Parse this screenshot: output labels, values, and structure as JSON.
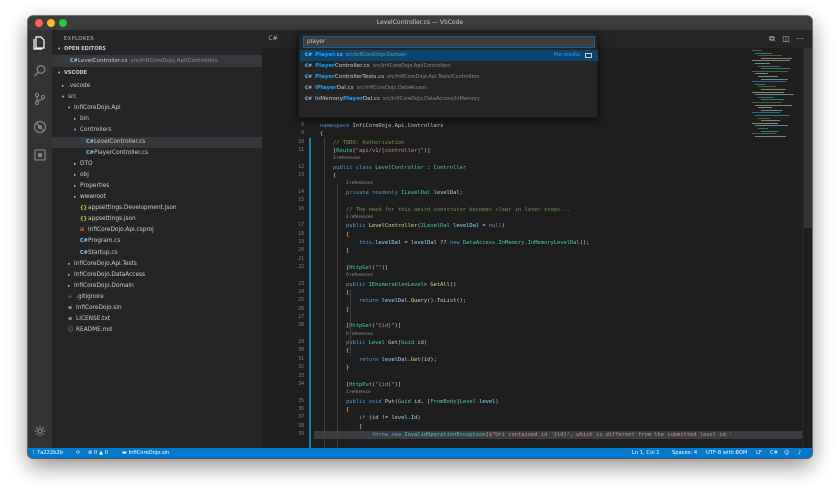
{
  "window": {
    "title": "LevelController.cs — VSCode"
  },
  "sidebar": {
    "title": "EXPLORER",
    "open_editors_label": "OPEN EDITORS",
    "open_editor": {
      "name": "LevelController.cs",
      "path": "src/InfiCoreDojo.Api/Controllers"
    },
    "workspace_label": "VSCODE",
    "tree": [
      {
        "label": ".vscode",
        "depth": 1,
        "chev": "▸",
        "icon": ""
      },
      {
        "label": "src",
        "depth": 1,
        "chev": "▾",
        "icon": ""
      },
      {
        "label": "InfiCoreDojo.Api",
        "depth": 2,
        "chev": "▾",
        "icon": ""
      },
      {
        "label": "bin",
        "depth": 3,
        "chev": "▸",
        "icon": ""
      },
      {
        "label": "Controllers",
        "depth": 3,
        "chev": "▾",
        "icon": ""
      },
      {
        "label": "LevelController.cs",
        "depth": 4,
        "chev": "",
        "icon": "C#",
        "selected": true
      },
      {
        "label": "PlayerController.cs",
        "depth": 4,
        "chev": "",
        "icon": "C#"
      },
      {
        "label": "DTO",
        "depth": 3,
        "chev": "▸",
        "icon": ""
      },
      {
        "label": "obj",
        "depth": 3,
        "chev": "▸",
        "icon": ""
      },
      {
        "label": "Properties",
        "depth": 3,
        "chev": "▸",
        "icon": ""
      },
      {
        "label": "wwwroot",
        "depth": 3,
        "chev": "▸",
        "icon": ""
      },
      {
        "label": "appsettings.Development.json",
        "depth": 3,
        "chev": "",
        "icon": "{}"
      },
      {
        "label": "appsettings.json",
        "depth": 3,
        "chev": "",
        "icon": "{}"
      },
      {
        "label": "InfiCoreDojo.Api.csproj",
        "depth": 3,
        "chev": "",
        "icon": "⊞"
      },
      {
        "label": "Program.cs",
        "depth": 3,
        "chev": "",
        "icon": "C#"
      },
      {
        "label": "Startup.cs",
        "depth": 3,
        "chev": "",
        "icon": "C#"
      },
      {
        "label": "InfiCoreDojo.Api.Tests",
        "depth": 2,
        "chev": "▸",
        "icon": ""
      },
      {
        "label": "InfiCoreDojo.DataAccess",
        "depth": 2,
        "chev": "▸",
        "icon": ""
      },
      {
        "label": "InfiCoreDojo.Domain",
        "depth": 2,
        "chev": "▸",
        "icon": ""
      },
      {
        "label": ".gitignore",
        "depth": 1,
        "chev": "",
        "icon": "◆"
      },
      {
        "label": "InfiCoreDojo.sln",
        "depth": 1,
        "chev": "",
        "icon": "≡"
      },
      {
        "label": "LICENSE.txt",
        "depth": 1,
        "chev": "",
        "icon": "≡"
      },
      {
        "label": "README.md",
        "depth": 1,
        "chev": "",
        "icon": "ⓘ"
      }
    ]
  },
  "quick_open": {
    "query": "player",
    "file_results_label": "file results",
    "results": [
      {
        "pre": "",
        "match": "Player",
        "post": ".cs",
        "path": "src/InfiCoreDojo.Domain",
        "selected": true
      },
      {
        "pre": "",
        "match": "Player",
        "post": "Controller.cs",
        "path": "src/InfiCoreDojo.Api/Controllers"
      },
      {
        "pre": "",
        "match": "Player",
        "post": "ControllerTests.cs",
        "path": "src/InfiCoreDojo.Api.Tests/Controllers"
      },
      {
        "pre": "I",
        "match": "Player",
        "post": "Dal.cs",
        "path": "src/InfiCoreDojo.DataAccess"
      },
      {
        "pre": "InMemory",
        "match": "Player",
        "post": "Dal.cs",
        "path": "src/InfiCoreDojo.DataAccess/InMemory"
      }
    ]
  },
  "code": [
    {
      "num": "8",
      "segs": [
        [
          "kw",
          "namespace "
        ],
        [
          "ns",
          "InfiCoreDojo.Api.Controllers"
        ]
      ]
    },
    {
      "num": "9",
      "segs": [
        [
          "tx",
          "{"
        ]
      ]
    },
    {
      "num": "10",
      "segs": [
        [
          "tx",
          "    "
        ],
        [
          "cm",
          "// TODO: Authorization"
        ]
      ]
    },
    {
      "num": "11",
      "segs": [
        [
          "tx",
          "    ["
        ],
        [
          "ty",
          "Route"
        ],
        [
          "tx",
          "("
        ],
        [
          "st",
          "\"api/v1/[controller]\""
        ],
        [
          "tx",
          ")]"
        ]
      ]
    },
    {
      "lens": "2 references",
      "indent": "    "
    },
    {
      "num": "12",
      "segs": [
        [
          "tx",
          "    "
        ],
        [
          "kw",
          "public class "
        ],
        [
          "ty",
          "LevelController"
        ],
        [
          "tx",
          " : "
        ],
        [
          "ty",
          "Controller"
        ]
      ]
    },
    {
      "num": "13",
      "segs": [
        [
          "tx",
          "    {"
        ]
      ]
    },
    {
      "lens": "3 references",
      "indent": "        "
    },
    {
      "num": "14",
      "segs": [
        [
          "tx",
          "        "
        ],
        [
          "kw",
          "private readonly "
        ],
        [
          "ty",
          "ILevelDal"
        ],
        [
          "tx",
          " "
        ],
        [
          "va",
          "levelDal"
        ],
        [
          "tx",
          ";"
        ]
      ]
    },
    {
      "num": "15",
      "segs": []
    },
    {
      "num": "16",
      "segs": [
        [
          "tx",
          "        "
        ],
        [
          "cm",
          "// The need for this weird construtor becomes clear in later steps..."
        ]
      ]
    },
    {
      "lens": "2 references",
      "indent": "        "
    },
    {
      "num": "17",
      "segs": [
        [
          "tx",
          "        "
        ],
        [
          "kw",
          "public "
        ],
        [
          "fn",
          "LevelController"
        ],
        [
          "tx",
          "("
        ],
        [
          "ty",
          "ILevelDal"
        ],
        [
          "tx",
          " "
        ],
        [
          "va",
          "levelDal"
        ],
        [
          "tx",
          " = "
        ],
        [
          "kw",
          "null"
        ],
        [
          "tx",
          ")"
        ]
      ]
    },
    {
      "num": "18",
      "segs": [
        [
          "tx",
          "        {"
        ]
      ]
    },
    {
      "num": "19",
      "segs": [
        [
          "tx",
          "            "
        ],
        [
          "kw",
          "this"
        ],
        [
          "tx",
          "."
        ],
        [
          "va",
          "levelDal"
        ],
        [
          "tx",
          " = "
        ],
        [
          "va",
          "levelDal"
        ],
        [
          "tx",
          " ?? "
        ],
        [
          "kw",
          "new "
        ],
        [
          "ty",
          "DataAccess.InMemory.InMemoryLevelDal"
        ],
        [
          "tx",
          "();"
        ]
      ]
    },
    {
      "num": "20",
      "segs": [
        [
          "tx",
          "        }"
        ]
      ]
    },
    {
      "num": "21",
      "segs": []
    },
    {
      "num": "22",
      "segs": [
        [
          "tx",
          "        ["
        ],
        [
          "ty",
          "HttpGet"
        ],
        [
          "tx",
          "("
        ],
        [
          "st",
          "\"\""
        ],
        [
          "tx",
          ")]"
        ]
      ]
    },
    {
      "lens": "0 references",
      "indent": "        "
    },
    {
      "num": "23",
      "segs": [
        [
          "tx",
          "        "
        ],
        [
          "kw",
          "public "
        ],
        [
          "ty",
          "IEnumerable"
        ],
        [
          "tx",
          "<"
        ],
        [
          "ty",
          "Level"
        ],
        [
          "tx",
          "> "
        ],
        [
          "fn",
          "GetAll"
        ],
        [
          "tx",
          "()"
        ]
      ]
    },
    {
      "num": "24",
      "segs": [
        [
          "tx",
          "        {"
        ]
      ]
    },
    {
      "num": "25",
      "segs": [
        [
          "tx",
          "            "
        ],
        [
          "kw",
          "return "
        ],
        [
          "va",
          "levelDal"
        ],
        [
          "tx",
          "."
        ],
        [
          "fn",
          "Query"
        ],
        [
          "tx",
          "()."
        ],
        [
          "fn",
          "ToList"
        ],
        [
          "tx",
          "();"
        ]
      ]
    },
    {
      "num": "26",
      "segs": [
        [
          "tx",
          "        }"
        ]
      ]
    },
    {
      "num": "27",
      "segs": []
    },
    {
      "num": "28",
      "segs": [
        [
          "tx",
          "        ["
        ],
        [
          "ty",
          "HttpGet"
        ],
        [
          "tx",
          "("
        ],
        [
          "st",
          "\"{id}\""
        ],
        [
          "tx",
          ")]"
        ]
      ]
    },
    {
      "lens": "0 references",
      "indent": "        "
    },
    {
      "num": "29",
      "segs": [
        [
          "tx",
          "        "
        ],
        [
          "kw",
          "public "
        ],
        [
          "ty",
          "Level"
        ],
        [
          "tx",
          " "
        ],
        [
          "fn",
          "Get"
        ],
        [
          "tx",
          "("
        ],
        [
          "ty",
          "Guid"
        ],
        [
          "tx",
          " "
        ],
        [
          "va",
          "id"
        ],
        [
          "tx",
          ")"
        ]
      ]
    },
    {
      "num": "30",
      "segs": [
        [
          "tx",
          "        {"
        ]
      ]
    },
    {
      "num": "31",
      "segs": [
        [
          "tx",
          "            "
        ],
        [
          "kw",
          "return "
        ],
        [
          "va",
          "levelDal"
        ],
        [
          "tx",
          "."
        ],
        [
          "fn",
          "Get"
        ],
        [
          "tx",
          "("
        ],
        [
          "va",
          "id"
        ],
        [
          "tx",
          ");"
        ]
      ]
    },
    {
      "num": "32",
      "segs": [
        [
          "tx",
          "        }"
        ]
      ]
    },
    {
      "num": "33",
      "segs": []
    },
    {
      "num": "34",
      "segs": [
        [
          "tx",
          "        ["
        ],
        [
          "ty",
          "HttpPut"
        ],
        [
          "tx",
          "("
        ],
        [
          "st",
          "\"{id}\""
        ],
        [
          "tx",
          ")]"
        ]
      ]
    },
    {
      "lens": "1 reference",
      "indent": "        "
    },
    {
      "num": "35",
      "segs": [
        [
          "tx",
          "        "
        ],
        [
          "kw",
          "public void "
        ],
        [
          "fn",
          "Put"
        ],
        [
          "tx",
          "("
        ],
        [
          "ty",
          "Guid"
        ],
        [
          "tx",
          " "
        ],
        [
          "va",
          "id"
        ],
        [
          "tx",
          ", ["
        ],
        [
          "ty",
          "FromBody"
        ],
        [
          "tx",
          "]"
        ],
        [
          "ty",
          "Level"
        ],
        [
          "tx",
          " "
        ],
        [
          "va",
          "level"
        ],
        [
          "tx",
          ")"
        ]
      ]
    },
    {
      "num": "36",
      "segs": [
        [
          "tx",
          "        {"
        ]
      ]
    },
    {
      "num": "37",
      "segs": [
        [
          "tx",
          "            "
        ],
        [
          "kw",
          "if "
        ],
        [
          "tx",
          "("
        ],
        [
          "va",
          "id"
        ],
        [
          "tx",
          " != "
        ],
        [
          "va",
          "level"
        ],
        [
          "tx",
          "."
        ],
        [
          "va",
          "Id"
        ],
        [
          "tx",
          ")"
        ]
      ]
    },
    {
      "num": "38",
      "segs": [
        [
          "tx",
          "            {"
        ]
      ]
    },
    {
      "num": "39",
      "highlight": true,
      "segs": [
        [
          "tx",
          "                "
        ],
        [
          "kw",
          "throw new "
        ],
        [
          "ty",
          "InvalidOperationException"
        ],
        [
          "tx",
          "("
        ],
        [
          "st",
          "$\"Uri contained id '{id}', which is different from the submitted level id '"
        ]
      ]
    }
  ],
  "colors": {
    "kw": "#569cd6",
    "ty": "#4ec9b0",
    "fn": "#dcdcaa",
    "st": "#ce9178",
    "cm": "#6a9955",
    "va": "#9cdcfe",
    "ns": "#d4d4d4",
    "tx": "#d4d4d4"
  },
  "status": {
    "branch": "7a222b2b",
    "sync": "⟳",
    "errors": "0",
    "warnings": "0",
    "project": "InfiCoreDojo.sln",
    "position": "Ln 1, Col 1",
    "spaces": "Spaces: 4",
    "encoding": "UTF-8 with BOM",
    "eol": "LF",
    "language": "C#"
  }
}
